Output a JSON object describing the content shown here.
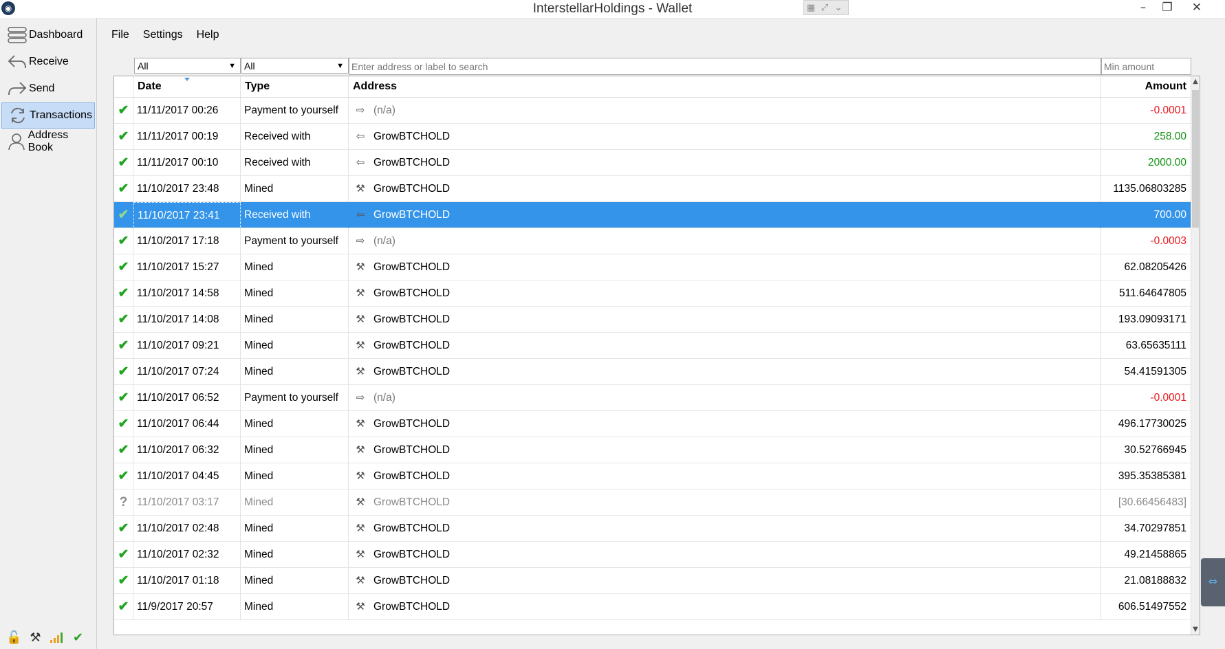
{
  "window": {
    "title": "InterstellarHoldings - Wallet",
    "minimize": "–",
    "restore": "❐",
    "close": "✕"
  },
  "sidebar": {
    "items": [
      {
        "label": "Dashboard",
        "icon": "dashboard-icon"
      },
      {
        "label": "Receive",
        "icon": "receive-icon"
      },
      {
        "label": "Send",
        "icon": "send-icon"
      },
      {
        "label": "Transactions",
        "icon": "transactions-icon",
        "active": true
      },
      {
        "label": "Address Book",
        "icon": "address-book-icon"
      }
    ],
    "status_icons": [
      "lock-icon",
      "mining-icon",
      "signal-icon",
      "synced-check-icon"
    ]
  },
  "menu": {
    "file": "File",
    "settings": "Settings",
    "help": "Help"
  },
  "filters": {
    "date_filter": "All",
    "type_filter": "All",
    "search_placeholder": "Enter address or label to search",
    "min_amount_placeholder": "Min amount"
  },
  "table": {
    "headers": {
      "date": "Date",
      "type": "Type",
      "address": "Address",
      "amount": "Amount"
    },
    "rows": [
      {
        "status": "✔",
        "date": "11/11/2017 00:26",
        "type": "Payment to yourself",
        "icon": "⇨",
        "address": "(n/a)",
        "amount": "-0.0001",
        "amount_class": "neg",
        "addr_class": "na"
      },
      {
        "status": "✔",
        "date": "11/11/2017 00:19",
        "type": "Received with",
        "icon": "⇦",
        "address": "GrowBTCHOLD",
        "amount": "258.00",
        "amount_class": "pos"
      },
      {
        "status": "✔",
        "date": "11/11/2017 00:10",
        "type": "Received with",
        "icon": "⇦",
        "address": "GrowBTCHOLD",
        "amount": "2000.00",
        "amount_class": "pos"
      },
      {
        "status": "✔",
        "date": "11/10/2017 23:48",
        "type": "Mined",
        "icon": "⚒",
        "address": "GrowBTCHOLD",
        "amount": "1135.06803285"
      },
      {
        "status": "✔",
        "date": "11/10/2017 23:41",
        "type": "Received with",
        "icon": "⇦",
        "address": "GrowBTCHOLD",
        "amount": "700.00",
        "selected": true
      },
      {
        "status": "✔",
        "date": "11/10/2017 17:18",
        "type": "Payment to yourself",
        "icon": "⇨",
        "address": "(n/a)",
        "amount": "-0.0003",
        "amount_class": "neg",
        "addr_class": "na"
      },
      {
        "status": "✔",
        "date": "11/10/2017 15:27",
        "type": "Mined",
        "icon": "⚒",
        "address": "GrowBTCHOLD",
        "amount": "62.08205426"
      },
      {
        "status": "✔",
        "date": "11/10/2017 14:58",
        "type": "Mined",
        "icon": "⚒",
        "address": "GrowBTCHOLD",
        "amount": "511.64647805"
      },
      {
        "status": "✔",
        "date": "11/10/2017 14:08",
        "type": "Mined",
        "icon": "⚒",
        "address": "GrowBTCHOLD",
        "amount": "193.09093171"
      },
      {
        "status": "✔",
        "date": "11/10/2017 09:21",
        "type": "Mined",
        "icon": "⚒",
        "address": "GrowBTCHOLD",
        "amount": "63.65635111"
      },
      {
        "status": "✔",
        "date": "11/10/2017 07:24",
        "type": "Mined",
        "icon": "⚒",
        "address": "GrowBTCHOLD",
        "amount": "54.41591305"
      },
      {
        "status": "✔",
        "date": "11/10/2017 06:52",
        "type": "Payment to yourself",
        "icon": "⇨",
        "address": "(n/a)",
        "amount": "-0.0001",
        "amount_class": "neg",
        "addr_class": "na"
      },
      {
        "status": "✔",
        "date": "11/10/2017 06:44",
        "type": "Mined",
        "icon": "⚒",
        "address": "GrowBTCHOLD",
        "amount": "496.17730025"
      },
      {
        "status": "✔",
        "date": "11/10/2017 06:32",
        "type": "Mined",
        "icon": "⚒",
        "address": "GrowBTCHOLD",
        "amount": "30.52766945"
      },
      {
        "status": "✔",
        "date": "11/10/2017 04:45",
        "type": "Mined",
        "icon": "⚒",
        "address": "GrowBTCHOLD",
        "amount": "395.35385381"
      },
      {
        "status": "?",
        "date": "11/10/2017 03:17",
        "type": "Mined",
        "icon": "⚒",
        "address": "GrowBTCHOLD",
        "amount": "[30.66456483]",
        "unconfirmed": true
      },
      {
        "status": "✔",
        "date": "11/10/2017 02:48",
        "type": "Mined",
        "icon": "⚒",
        "address": "GrowBTCHOLD",
        "amount": "34.70297851"
      },
      {
        "status": "✔",
        "date": "11/10/2017 02:32",
        "type": "Mined",
        "icon": "⚒",
        "address": "GrowBTCHOLD",
        "amount": "49.21458865"
      },
      {
        "status": "✔",
        "date": "11/10/2017 01:18",
        "type": "Mined",
        "icon": "⚒",
        "address": "GrowBTCHOLD",
        "amount": "21.08188832"
      },
      {
        "status": "✔",
        "date": "11/9/2017 20:57",
        "type": "Mined",
        "icon": "⚒",
        "address": "GrowBTCHOLD",
        "amount": "606.51497552"
      }
    ]
  },
  "colors": {
    "selected_row": "#3394ea",
    "negative_amount": "#e8171d",
    "positive_amount": "#149314",
    "confirmed_check": "#1fa51f",
    "active_nav": "#c7dcf6"
  }
}
